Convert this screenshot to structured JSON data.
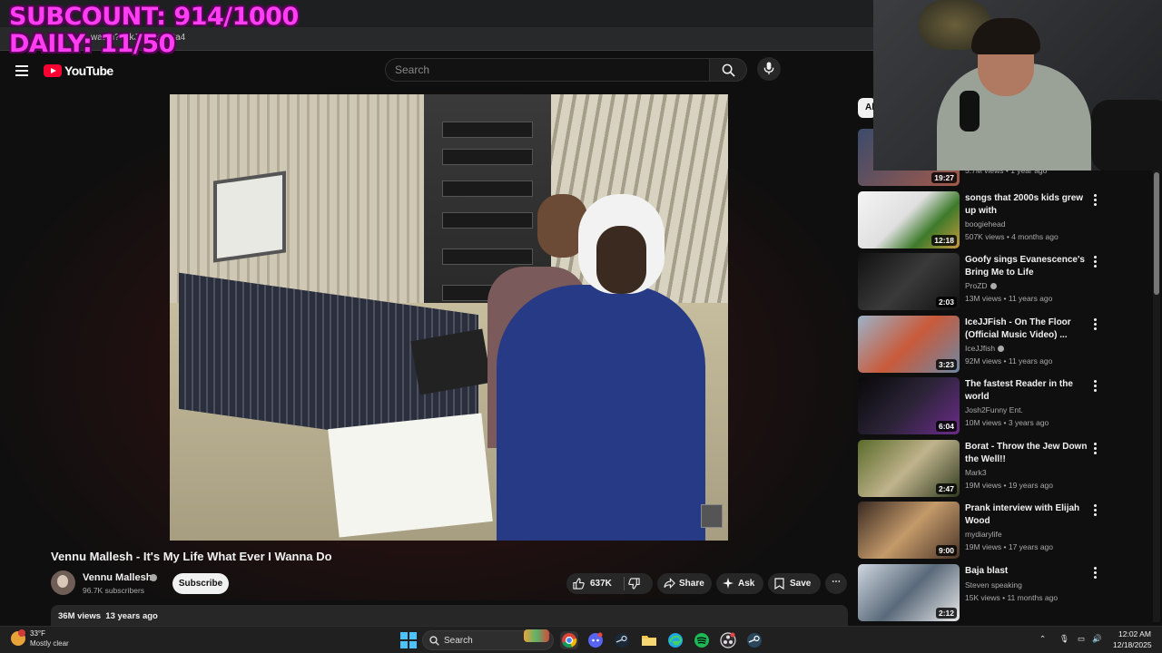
{
  "browser": {
    "url": "watch?v=kJa2kwoZ2a4"
  },
  "overlay": {
    "line1": "SUBCOUNT: 914/1000",
    "line2": "DAILY: 11/50"
  },
  "header": {
    "logo_text": "YouTube",
    "search_placeholder": "Search"
  },
  "video": {
    "title": "Vennu Mallesh - It's My Life What Ever I Wanna Do",
    "channel": "Vennu Mallesh",
    "subscribers": "96.7K subscribers",
    "subscribe_label": "Subscribe",
    "likes": "637K",
    "share_label": "Share",
    "ask_label": "Ask",
    "save_label": "Save",
    "views": "36M views",
    "age": "13 years ago"
  },
  "sidebar": {
    "chip_label": "All",
    "recommendations": [
      {
        "title": "",
        "channel": "",
        "meta": "5.7M views • 1 year ago",
        "duration": "19:27",
        "verified": false
      },
      {
        "title": "songs that 2000s kids grew up with",
        "channel": "boogiehead",
        "meta": "507K views • 4 months ago",
        "duration": "12:18",
        "verified": false
      },
      {
        "title": "Goofy sings Evanescence's Bring Me to Life",
        "channel": "ProZD",
        "meta": "13M views • 11 years ago",
        "duration": "2:03",
        "verified": true
      },
      {
        "title": "IceJJFish - On The Floor (Official Music Video) ...",
        "channel": "IceJJfish",
        "meta": "92M views • 11 years ago",
        "duration": "3:23",
        "verified": true
      },
      {
        "title": "The fastest Reader in the world",
        "channel": "Josh2Funny Ent.",
        "meta": "10M views • 3 years ago",
        "duration": "6:04",
        "verified": false
      },
      {
        "title": "Borat - Throw the Jew Down the Well!!",
        "channel": "Mark3",
        "meta": "19M views • 19 years ago",
        "duration": "2:47",
        "verified": false
      },
      {
        "title": "Prank interview with Elijah Wood",
        "channel": "mydiarylife",
        "meta": "19M views • 17 years ago",
        "duration": "9:00",
        "verified": false
      },
      {
        "title": "Baja blast",
        "channel": "Steven speaking",
        "meta": "15K views • 11 months ago",
        "duration": "2:12",
        "verified": false
      }
    ]
  },
  "taskbar": {
    "weather_temp": "33°F",
    "weather_condition": "Mostly clear",
    "search_label": "Search",
    "time": "12:02 AM",
    "date": "12/18/2025"
  }
}
